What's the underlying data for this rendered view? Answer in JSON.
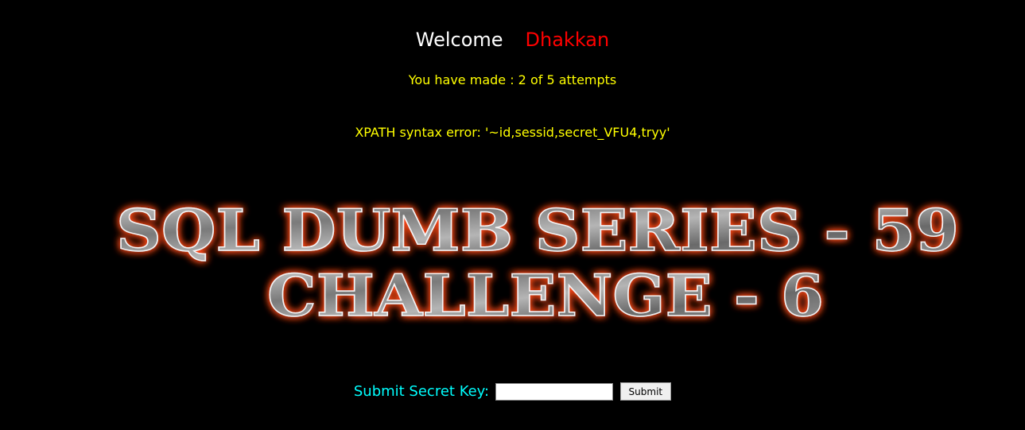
{
  "header": {
    "welcome_label": "Welcome",
    "user_name": "Dhakkan"
  },
  "status": {
    "attempts_text": "You have made : 2 of 5 attempts",
    "error_text": "XPATH syntax error: '~id,sessid,secret_VFU4,tryy'"
  },
  "banner": {
    "line1": "SQL DUMB SERIES - 59",
    "line2": "CHALLENGE - 6"
  },
  "form": {
    "label": "Submit Secret Key:",
    "input_value": "",
    "submit_label": "Submit"
  },
  "colors": {
    "background": "#000000",
    "welcome": "#ffffff",
    "user_name": "#ff0000",
    "status_text": "#ffff00",
    "form_label": "#00ffff",
    "banner_glow": "#ff4a1c"
  }
}
